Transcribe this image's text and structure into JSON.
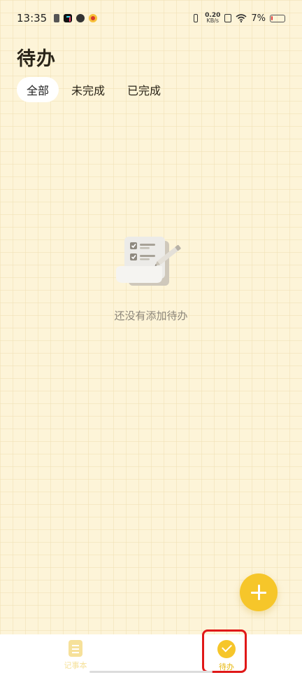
{
  "status_bar": {
    "time": "13:35",
    "net_speed_value": "0.20",
    "net_speed_unit": "KB/s",
    "battery_text": "7%",
    "battery_level": 0.07,
    "icons": [
      "sim-icon",
      "tiktok-icon",
      "link-icon",
      "weibo-icon",
      "vibrate-icon",
      "sim-x-icon",
      "wifi-icon",
      "battery-icon"
    ]
  },
  "page": {
    "title": "待办"
  },
  "tabs": [
    {
      "label": "全部",
      "active": true
    },
    {
      "label": "未完成",
      "active": false
    },
    {
      "label": "已完成",
      "active": false
    }
  ],
  "empty_state": {
    "text": "还没有添加待办",
    "icon": "checklist-illustration"
  },
  "fab": {
    "icon": "plus-icon",
    "color": "#f6c62a"
  },
  "bottom_nav": {
    "items": [
      {
        "label": "记事本",
        "icon": "notebook-icon",
        "active": false
      },
      {
        "label": "待办",
        "icon": "check-circle-icon",
        "active": true
      }
    ]
  },
  "colors": {
    "background": "#fdf4d8",
    "accent": "#f6c62a",
    "highlight": "#e01818"
  }
}
